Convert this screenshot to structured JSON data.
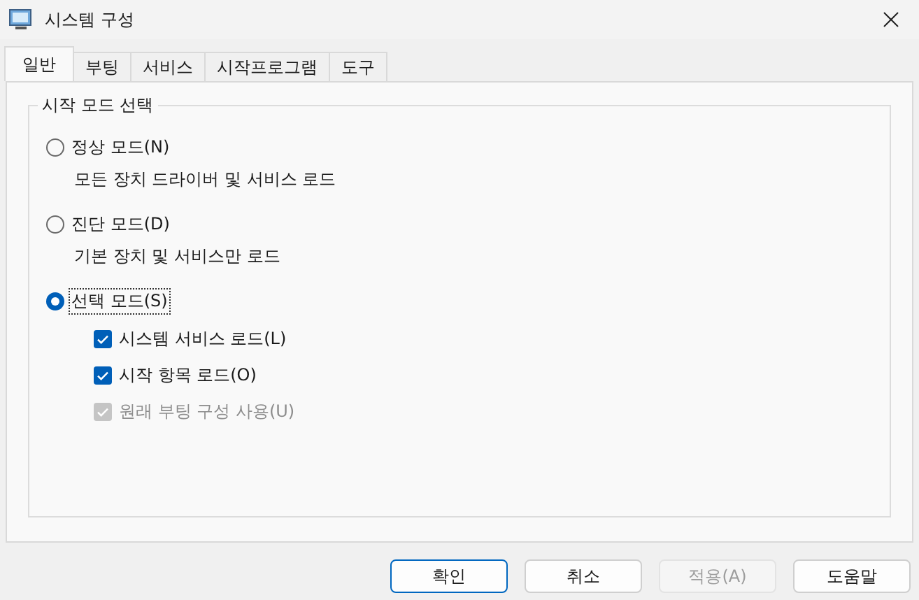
{
  "window": {
    "title": "시스템 구성"
  },
  "tabs": [
    {
      "label": "일반",
      "selected": true
    },
    {
      "label": "부팅",
      "selected": false
    },
    {
      "label": "서비스",
      "selected": false
    },
    {
      "label": "시작프로그램",
      "selected": false
    },
    {
      "label": "도구",
      "selected": false
    }
  ],
  "startup_selection": {
    "title": "시작 모드 선택",
    "modes": [
      {
        "label": "정상 모드(N)",
        "description": "모든 장치 드라이버 및 서비스 로드",
        "selected": false,
        "focused": false
      },
      {
        "label": "진단 모드(D)",
        "description": "기본 장치 및 서비스만 로드",
        "selected": false,
        "focused": false
      },
      {
        "label": "선택 모드(S)",
        "selected": true,
        "focused": true,
        "options": [
          {
            "label": "시스템 서비스 로드(L)",
            "checked": true,
            "disabled": false
          },
          {
            "label": "시작 항목 로드(O)",
            "checked": true,
            "disabled": false
          },
          {
            "label": "원래 부팅 구성 사용(U)",
            "checked": true,
            "disabled": true
          }
        ]
      }
    ]
  },
  "buttons": [
    {
      "label": "확인",
      "default": true,
      "disabled": false
    },
    {
      "label": "취소",
      "default": false,
      "disabled": false
    },
    {
      "label": "적용(A)",
      "default": false,
      "disabled": true
    },
    {
      "label": "도움말",
      "default": false,
      "disabled": false
    }
  ]
}
